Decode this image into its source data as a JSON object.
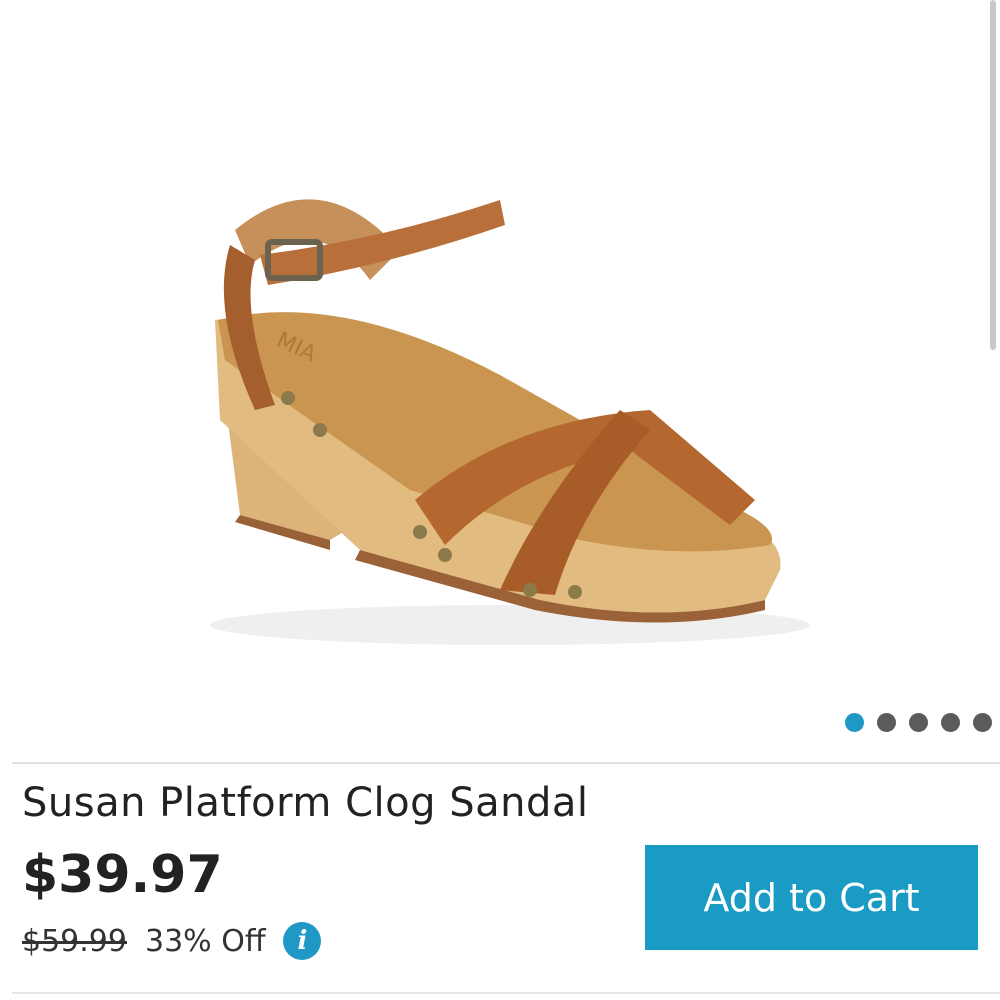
{
  "product": {
    "title": "Susan Platform Clog Sandal",
    "price": "$39.97",
    "original_price": "$59.99",
    "discount": "33% Off",
    "image_alt": "Susan Platform Clog Sandal",
    "image_icon": "sandal-product-photo"
  },
  "carousel": {
    "dot_count": 5,
    "active_index": 0
  },
  "actions": {
    "add_to_cart_label": "Add to Cart",
    "info_icon": "info-icon"
  },
  "colors": {
    "accent": "#1a9bc4",
    "text": "#222222",
    "inactive_dot": "#5b5b5b"
  }
}
